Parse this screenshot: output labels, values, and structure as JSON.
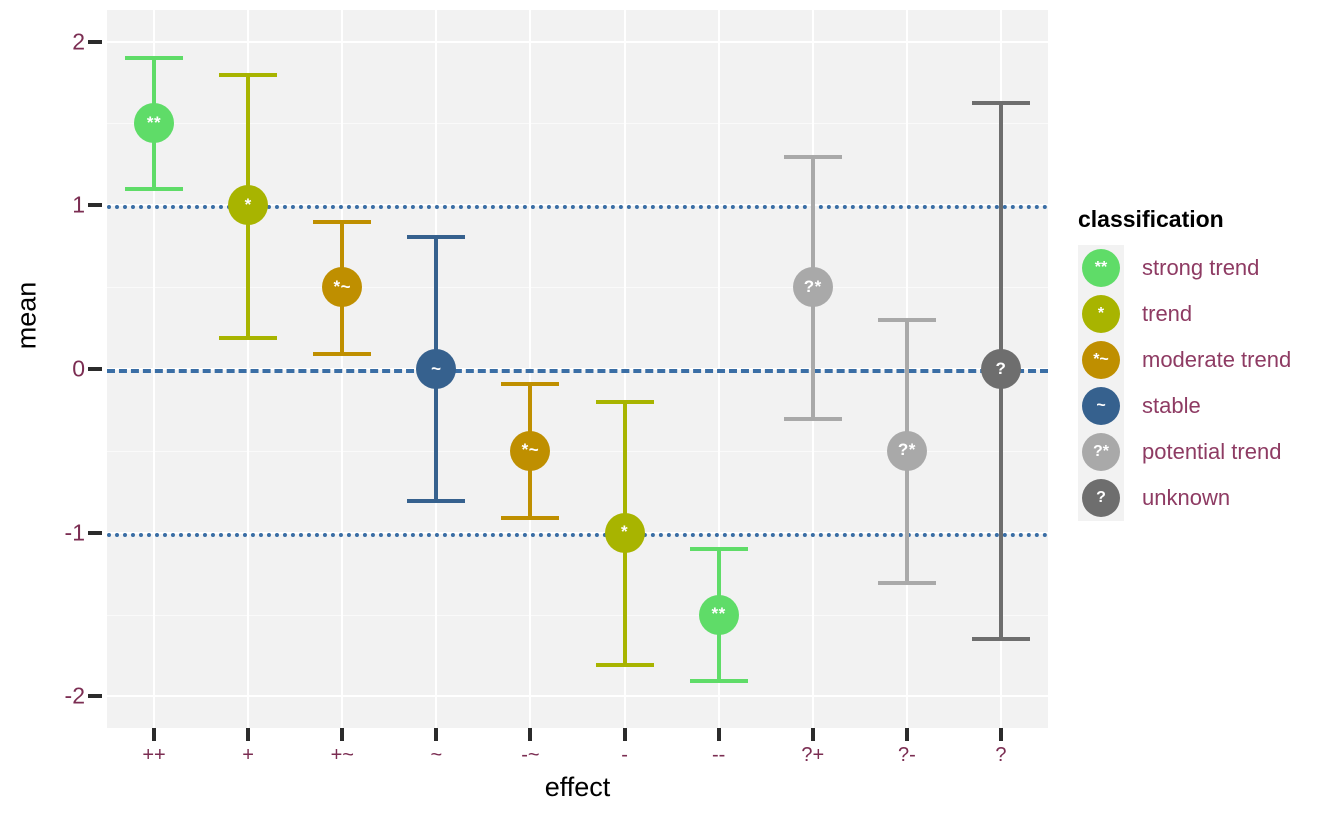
{
  "chart_data": {
    "type": "scatter",
    "title": "",
    "xlabel": "effect",
    "ylabel": "mean",
    "ylim": [
      -2.2,
      2.2
    ],
    "y_ticks": [
      2,
      1,
      0,
      -1,
      -2
    ],
    "y_tick_labels": [
      "2",
      "1",
      "0",
      "-1",
      "-2"
    ],
    "grid": true,
    "legend_position": "right",
    "categories": [
      "++",
      "+",
      "+~",
      "~",
      "-~",
      "-",
      "--",
      "?+",
      "?-",
      "?"
    ],
    "reference_lines": [
      {
        "y": 1,
        "style": "dotted",
        "color": "#3A6EA5"
      },
      {
        "y": 0,
        "style": "dashed",
        "color": "#3A6EA5"
      },
      {
        "y": -1,
        "style": "dotted",
        "color": "#3A6EA5"
      }
    ],
    "points": [
      {
        "x": "++",
        "mean": 1.5,
        "lower": 1.09,
        "upper": 1.91,
        "classification": "strong trend",
        "glyph": "**",
        "color": "#5FDC68"
      },
      {
        "x": "+",
        "mean": 1.0,
        "lower": 0.18,
        "upper": 1.81,
        "classification": "trend",
        "glyph": "*",
        "color": "#A8B400"
      },
      {
        "x": "+~",
        "mean": 0.5,
        "lower": 0.08,
        "upper": 0.91,
        "classification": "moderate trend",
        "glyph": "*~",
        "color": "#BF8F00"
      },
      {
        "x": "~",
        "mean": 0.0,
        "lower": -0.82,
        "upper": 0.82,
        "classification": "stable",
        "glyph": "~",
        "color": "#36618E"
      },
      {
        "x": "-~",
        "mean": -0.5,
        "lower": -0.92,
        "upper": -0.08,
        "classification": "moderate trend",
        "glyph": "*~",
        "color": "#BF8F00"
      },
      {
        "x": "-",
        "mean": -1.0,
        "lower": -1.82,
        "upper": -0.19,
        "classification": "trend",
        "glyph": "*",
        "color": "#A8B400"
      },
      {
        "x": "--",
        "mean": -1.5,
        "lower": -1.92,
        "upper": -1.09,
        "classification": "strong trend",
        "glyph": "**",
        "color": "#5FDC68"
      },
      {
        "x": "?+",
        "mean": 0.5,
        "lower": -0.32,
        "upper": 1.31,
        "classification": "potential trend",
        "glyph": "?*",
        "color": "#A9A9A9"
      },
      {
        "x": "?-",
        "mean": -0.5,
        "lower": -1.32,
        "upper": 0.31,
        "classification": "potential trend",
        "glyph": "?*",
        "color": "#A9A9A9"
      },
      {
        "x": "?",
        "mean": 0.0,
        "lower": -1.66,
        "upper": 1.64,
        "classification": "unknown",
        "glyph": "?",
        "color": "#6E6E6E"
      }
    ],
    "legend": {
      "title": "classification",
      "entries": [
        {
          "label": "strong trend",
          "glyph": "**",
          "color": "#5FDC68"
        },
        {
          "label": "trend",
          "glyph": "*",
          "color": "#A8B400"
        },
        {
          "label": "moderate trend",
          "glyph": "*~",
          "color": "#BF8F00"
        },
        {
          "label": "stable",
          "glyph": "~",
          "color": "#36618E"
        },
        {
          "label": "potential trend",
          "glyph": "?*",
          "color": "#A9A9A9"
        },
        {
          "label": "unknown",
          "glyph": "?",
          "color": "#6E6E6E"
        }
      ]
    },
    "colors": {
      "panel_background": "#F2F2F2",
      "gridline": "#FFFFFF",
      "axis_text": "#7B2D52",
      "axis_title": "#000000",
      "legend_label": "#8E3B63",
      "reference_line": "#3A6EA5"
    }
  }
}
